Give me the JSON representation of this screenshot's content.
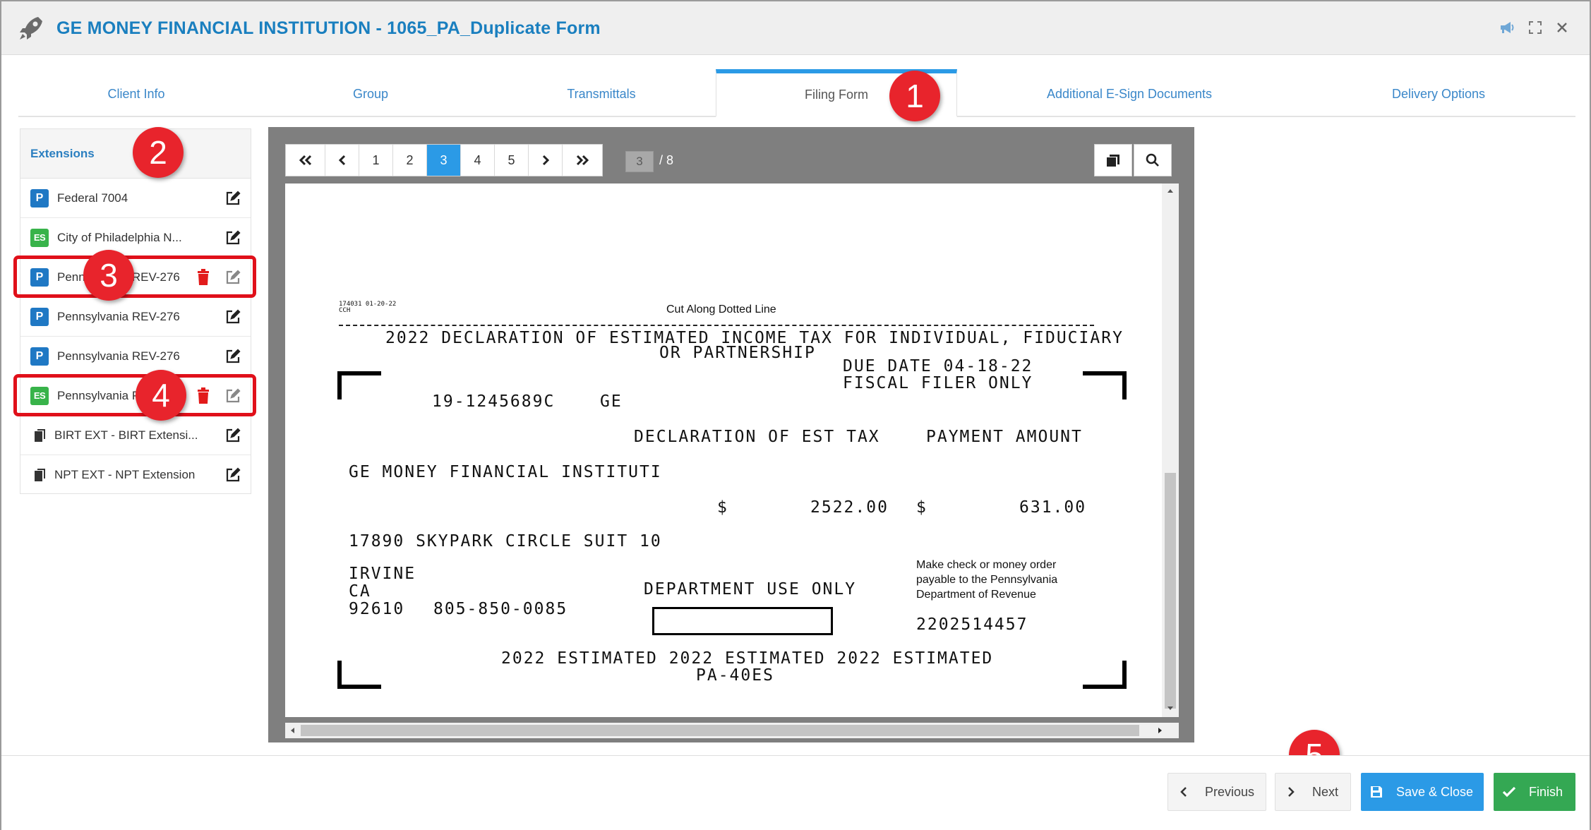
{
  "window": {
    "title": "GE MONEY FINANCIAL INSTITUTION - 1065_PA_Duplicate Form"
  },
  "tabs": [
    {
      "label": "Client Info"
    },
    {
      "label": "Group"
    },
    {
      "label": "Transmittals"
    },
    {
      "label": "Filing Form",
      "active": true
    },
    {
      "label": "Additional E-Sign Documents"
    },
    {
      "label": "Delivery Options"
    }
  ],
  "sidebar": {
    "heading": "Extensions",
    "items": [
      {
        "badge": "P",
        "label": "Federal 7004"
      },
      {
        "badge": "ES",
        "label": "City of Philadelphia N..."
      },
      {
        "badge": "P",
        "label": "Pennsylvania REV-276"
      },
      {
        "badge": "P",
        "label": "Pennsylvania REV-276"
      },
      {
        "badge": "P",
        "label": "Pennsylvania REV-276"
      },
      {
        "badge": "ES",
        "label": "Pennsylvania PA"
      },
      {
        "badge": "doc",
        "label": "BIRT EXT - BIRT Extensi..."
      },
      {
        "badge": "doc",
        "label": "NPT EXT - NPT Extension"
      }
    ]
  },
  "callouts": [
    "1",
    "2",
    "3",
    "4",
    "5"
  ],
  "pager": {
    "pages": [
      "1",
      "2",
      "3",
      "4",
      "5"
    ],
    "current": "3",
    "total": "/ 8"
  },
  "form": {
    "code_line1": "174031 01-20-22",
    "code_line2": "CCH",
    "cut_line": "Cut Along Dotted Line",
    "heading1": "2022 DECLARATION OF ESTIMATED INCOME TAX FOR INDIVIDUAL, FIDUCIARY",
    "heading2": "OR PARTNERSHIP",
    "due_date": "DUE DATE  04-18-22",
    "fiscal": "FISCAL FILER ONLY",
    "ein": "19-1245689C",
    "name_code": "GE",
    "decl_label": "DECLARATION OF EST TAX",
    "pay_label": "PAYMENT AMOUNT",
    "entity_name": "GE MONEY FINANCIAL INSTITUTI",
    "dollar1": "$",
    "decl_amount": "2522.00",
    "dollar2": "$",
    "pay_amount": "631.00",
    "address": "17890 SKYPARK CIRCLE SUIT 10",
    "city": "IRVINE",
    "state": "CA",
    "zip": "92610",
    "phone": "805-850-0085",
    "dept_use": "DEPARTMENT USE ONLY",
    "check_note1": "Make check or money order",
    "check_note2": "payable to the Pennsylvania",
    "check_note3": "Department of Revenue",
    "scan_number": "2202514457",
    "footer1": "2022 ESTIMATED 2022 ESTIMATED 2022 ESTIMATED",
    "footer2": "PA-40ES"
  },
  "footer": {
    "previous": "Previous",
    "next": "Next",
    "save_close": "Save & Close",
    "finish": "Finish"
  },
  "colors": {
    "accent": "#2b9ae6",
    "title": "#1a7fbf",
    "callout": "#e8242c",
    "highlight": "#e0101a",
    "finish": "#34a853",
    "badge_p": "#1f78c4",
    "badge_es": "#38b34a"
  }
}
